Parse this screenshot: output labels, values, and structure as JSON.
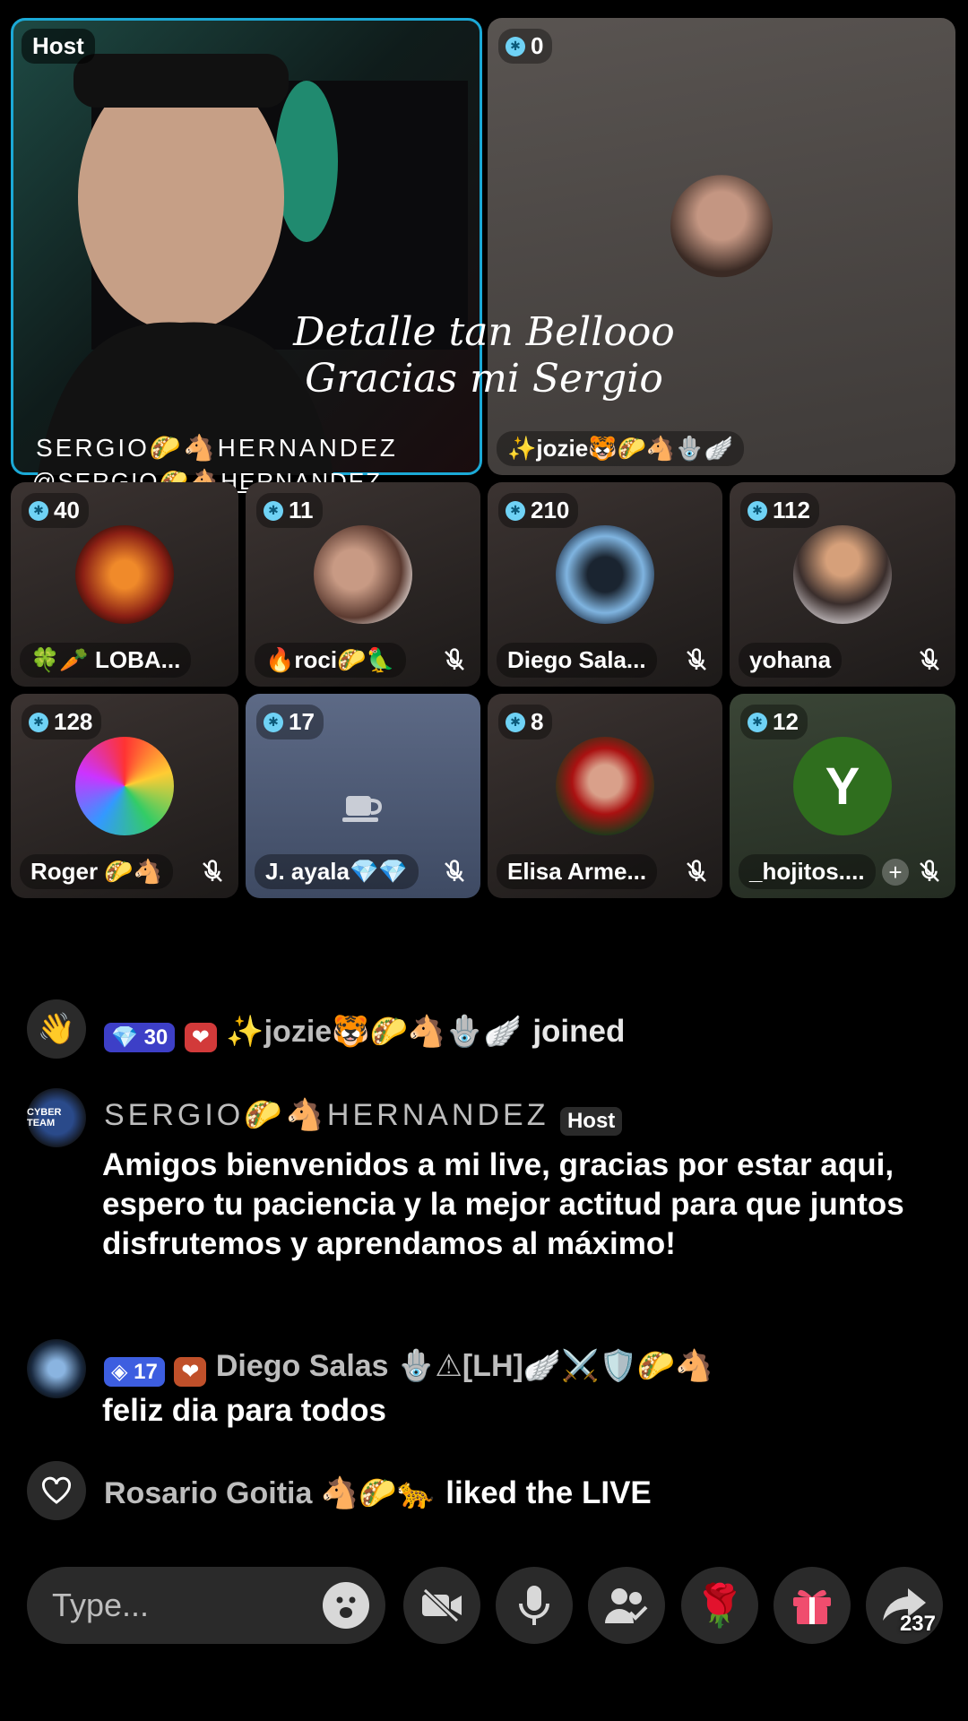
{
  "overlay": {
    "line1": "Detalle tan Bellooo",
    "line2": "Gracias mi Sergio",
    "handle": "@SERGIO🌮🐴HERNANDEZ"
  },
  "tiles": [
    {
      "label": "Host",
      "name": "SERGIO🌮🐴HERNANDEZ"
    },
    {
      "count": "0",
      "name": "✨jozie🐯🌮🐴🪬🪽"
    },
    {
      "count": "40",
      "name": "🍀🥕 LOBA..."
    },
    {
      "count": "11",
      "name": "🔥roci🌮🦜"
    },
    {
      "count": "210",
      "name": "Diego Sala..."
    },
    {
      "count": "112",
      "name": "yohana"
    },
    {
      "count": "128",
      "name": "Roger 🌮🐴"
    },
    {
      "count": "17",
      "name": "J. ayala💎💎"
    },
    {
      "count": "8",
      "name": "Elisa Arme..."
    },
    {
      "count": "12",
      "name": "_hojitos....",
      "initial": "Y"
    }
  ],
  "chat": {
    "joined": {
      "level": "30",
      "name": "✨jozie🐯🌮🐴🪬🪽",
      "action": "joined"
    },
    "host_msg": {
      "name": "SERGIO🌮🐴HERNANDEZ",
      "tag": "Host",
      "avatar_text": "CYBER TEAM",
      "text": "Amigos bienvenidos a mi live, gracias por estar aqui, espero tu paciencia y la mejor actitud para que juntos disfrutemos y aprendamos al máximo!"
    },
    "diego_msg": {
      "level": "17",
      "name": "Diego Salas 🪬⚠[LH]🪽⚔️🛡️🌮🐴",
      "text": "feliz dia para todos"
    },
    "like": {
      "name": "Rosario Goitia 🐴🌮🐆",
      "action": "liked the LIVE"
    }
  },
  "bottom": {
    "placeholder": "Type...",
    "share_count": "237"
  }
}
